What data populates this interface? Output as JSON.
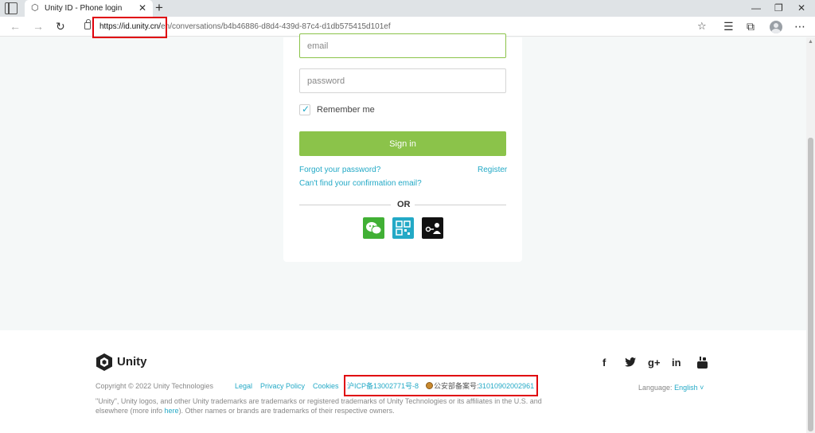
{
  "browser": {
    "tab_title": "Unity ID - Phone login",
    "url_host": "https://id.unity.cn/",
    "url_path": "en/conversations/b4b46886-d8d4-439d-87c4-d1db575415d101ef"
  },
  "login": {
    "email_placeholder": "email",
    "password_placeholder": "password",
    "remember_label": "Remember me",
    "remember_checked": true,
    "signin_label": "Sign in",
    "forgot_password": "Forgot your password?",
    "register": "Register",
    "confirmation_email": "Can't find your confirmation email?",
    "or_label": "OR",
    "social_icons": [
      "wechat-icon",
      "qr-code-icon",
      "key-user-icon"
    ]
  },
  "footer": {
    "logo_text": "Unity",
    "copyright": "Copyright © 2022 Unity Technologies",
    "links": {
      "legal": "Legal",
      "privacy": "Privacy Policy",
      "cookies": "Cookies",
      "icp": "沪ICP备13002771号-8"
    },
    "police_label": "公安部备案号:",
    "police_number": "31010902002961",
    "trademark_before": "\"Unity\", Unity logos, and other Unity trademarks are trademarks or registered trademarks of Unity Technologies or its affiliates in the U.S. and elsewhere (more info ",
    "trademark_link": "here",
    "trademark_after": "). Other names or brands are trademarks of their respective owners.",
    "language_label": "Language:",
    "language_value": "English",
    "social": [
      "facebook-icon",
      "twitter-icon",
      "google-plus-icon",
      "linkedin-icon",
      "youtube-icon"
    ]
  },
  "colors": {
    "accent": "#23a9c6",
    "button_green": "#8bc34a",
    "wechat_green": "#41b035",
    "highlight_red": "#e0000b"
  }
}
